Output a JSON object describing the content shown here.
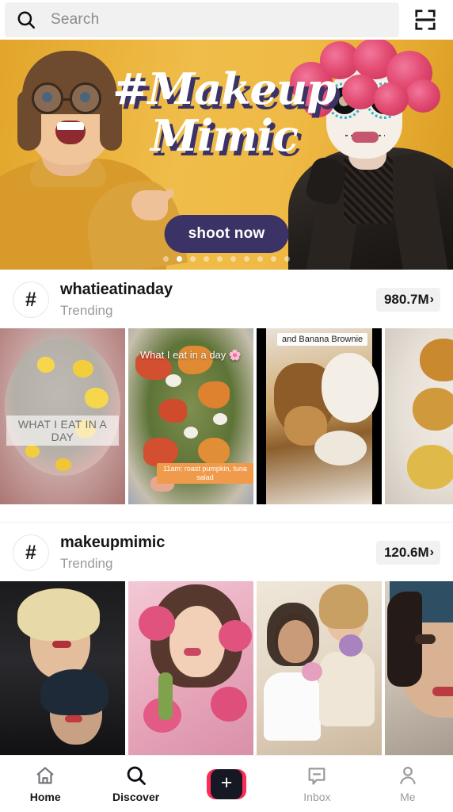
{
  "search": {
    "placeholder": "Search",
    "value": "",
    "icon": "search-icon",
    "scan_icon": "scan-icon"
  },
  "banner": {
    "title_line1": "#Makeup",
    "title_line2": "Mimic",
    "cta_label": "shoot now",
    "background_color": "#E9B037",
    "title_shadow_color": "#3B3365",
    "cta_color": "#3B3365",
    "dots_total": 10,
    "dots_active_index": 1
  },
  "sections": [
    {
      "avatar_glyph": "#",
      "name": "whatieatinaday",
      "subtitle": "Trending",
      "count": "980.7M",
      "chevron": "›",
      "thumbnails": [
        {
          "name": "chia-mango-bowl",
          "caption_box": "WHAT I EAT IN A DAY"
        },
        {
          "name": "pumpkin-tuna-salad",
          "caption_center": "What I eat in a day 🌸",
          "caption_orange": "11am: roast pumpkin, tuna salad"
        },
        {
          "name": "banana-brownie-plate",
          "caption_white": "and Banana Brownie"
        },
        {
          "name": "falafel-balls-plate"
        }
      ]
    },
    {
      "avatar_glyph": "#",
      "name": "makeupmimic",
      "subtitle": "Trending",
      "count": "120.6M",
      "chevron": "›",
      "thumbnails": [
        {
          "name": "marilyn-mimic"
        },
        {
          "name": "pink-daisy-makeup"
        },
        {
          "name": "white-dress-duo"
        },
        {
          "name": "blue-headband-makeup"
        }
      ]
    }
  ],
  "bottom_nav": {
    "items": [
      {
        "label": "Home",
        "icon": "home-icon",
        "active": false
      },
      {
        "label": "Discover",
        "icon": "search-icon",
        "active": true
      },
      {
        "label": "",
        "icon": "create-plus-icon",
        "active": false
      },
      {
        "label": "Inbox",
        "icon": "inbox-icon",
        "active": false
      },
      {
        "label": "Me",
        "icon": "person-icon",
        "active": false
      }
    ],
    "create_colors": {
      "cyan": "#25F4EE",
      "pink": "#FE2C55",
      "center": "#161823"
    }
  }
}
